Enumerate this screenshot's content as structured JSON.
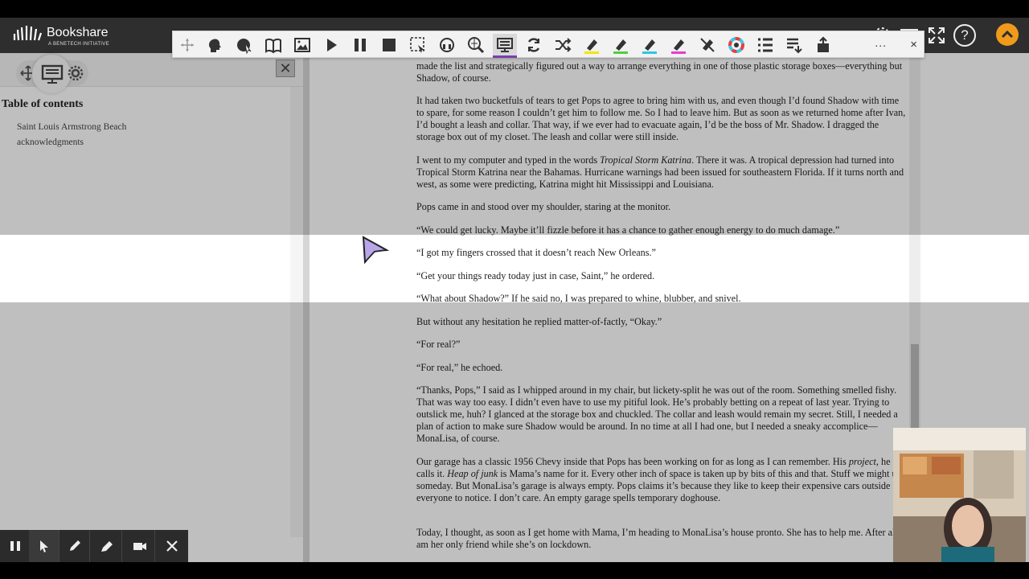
{
  "app": {
    "logo_name": "Bookshare",
    "logo_sub": "A BENETECH INITIATIVE",
    "help_label": "?"
  },
  "colors": {
    "accent_orange": "#f09a1c",
    "active_tool_underline": "#7a3fa8",
    "header_bg": "#2e2e2e"
  },
  "toolbar": {
    "more_label": "...",
    "close_label": "×",
    "tools": [
      "move-handle-icon",
      "speak-head-icon",
      "click-speak-icon",
      "dictionary-book-icon",
      "picture-dictionary-icon",
      "play-icon",
      "pause-icon",
      "stop-icon",
      "screen-mask-icon",
      "audio-maker-icon",
      "web-search-icon",
      "screen-masking-icon",
      "translate-icon",
      "random-icon",
      "highlighter-yellow-icon",
      "highlighter-green-icon",
      "highlighter-cyan-icon",
      "highlighter-pink-icon",
      "highlight-clear-icon",
      "color-wheel-icon",
      "list-icon",
      "collect-highlights-icon",
      "share-icon"
    ]
  },
  "sidebar": {
    "close_label": "✕",
    "toc_title": "Table of contents",
    "toc_items": [
      "Saint Louis Armstrong Beach",
      "acknowledgments"
    ]
  },
  "reader": {
    "paragraphs": [
      "made the list and strategically figured out a way to arrange everything in one of those plastic storage boxes—everything but Shadow, of course.",
      "It had taken two bucketfuls of tears to get Pops to agree to bring him with us, and even though I’d found Shadow with time to spare, for some reason I couldn’t get him to follow me. So I had to leave him. But as soon as we returned home after Ivan, I’d bought a leash and collar. That way, if we ever had to evacuate again, I’d be the boss of Mr. Shadow. I dragged the storage box out of my closet. The leash and collar were still inside.",
      "I went to my computer and typed in the words ",
      "Tropical Storm Katrina",
      ". There it was. A tropical depression had turned into Tropical Storm Katrina near the Bahamas. Hurricane warnings had been issued for southeastern Florida. If it turns north and west, as some were predicting, Katrina might hit Mississippi and Louisiana.",
      "Pops came in and stood over my shoulder, staring at the monitor.",
      "“We could get lucky. Maybe it’ll fizzle before it has a chance to gather enough energy to do much damage.”",
      "“I got my fingers crossed that it doesn’t reach New Orleans.”",
      "“Get your things ready today just in case, Saint,” he ordered.",
      "“What about Shadow?” If he said no, I was prepared to whine, blubber, and snivel.",
      "But without any hesitation he replied matter-of-factly, “Okay.”",
      "“For real?”",
      "“For real,” he echoed.",
      "“Thanks, Pops,” I said as I whipped around in my chair, but lickety-split he was out of the room. Something smelled fishy. That was way too easy. I didn’t even have to use my pitiful look. He’s probably betting on a repeat of last year. Trying to outslick me, huh? I glanced at the storage box and chuckled. The collar and leash would remain my secret. Still, I needed a plan of action to make sure Shadow would be around. In no time at all I had one, but I needed a sneaky accomplice—MonaLisa, of course.",
      "Our garage has a classic 1956 Chevy inside that Pops has been working on for as long as I can remember. His ",
      "project,",
      " he calls it. ",
      "Heap of junk",
      " is Mama’s name for it. Every other inch of space is taken up by bits of this and that. Stuff we might use someday. But MonaLisa’s garage is always empty. Pops claims it’s because they like to keep their expensive cars outside for everyone to notice. I don’t care. An empty garage spells temporary doghouse.",
      "Today, I thought, as soon as I get home with Mama, I’m heading to MonaLisa’s house pronto. She has to help me. After all, I am her only friend while she’s on lockdown."
    ]
  }
}
